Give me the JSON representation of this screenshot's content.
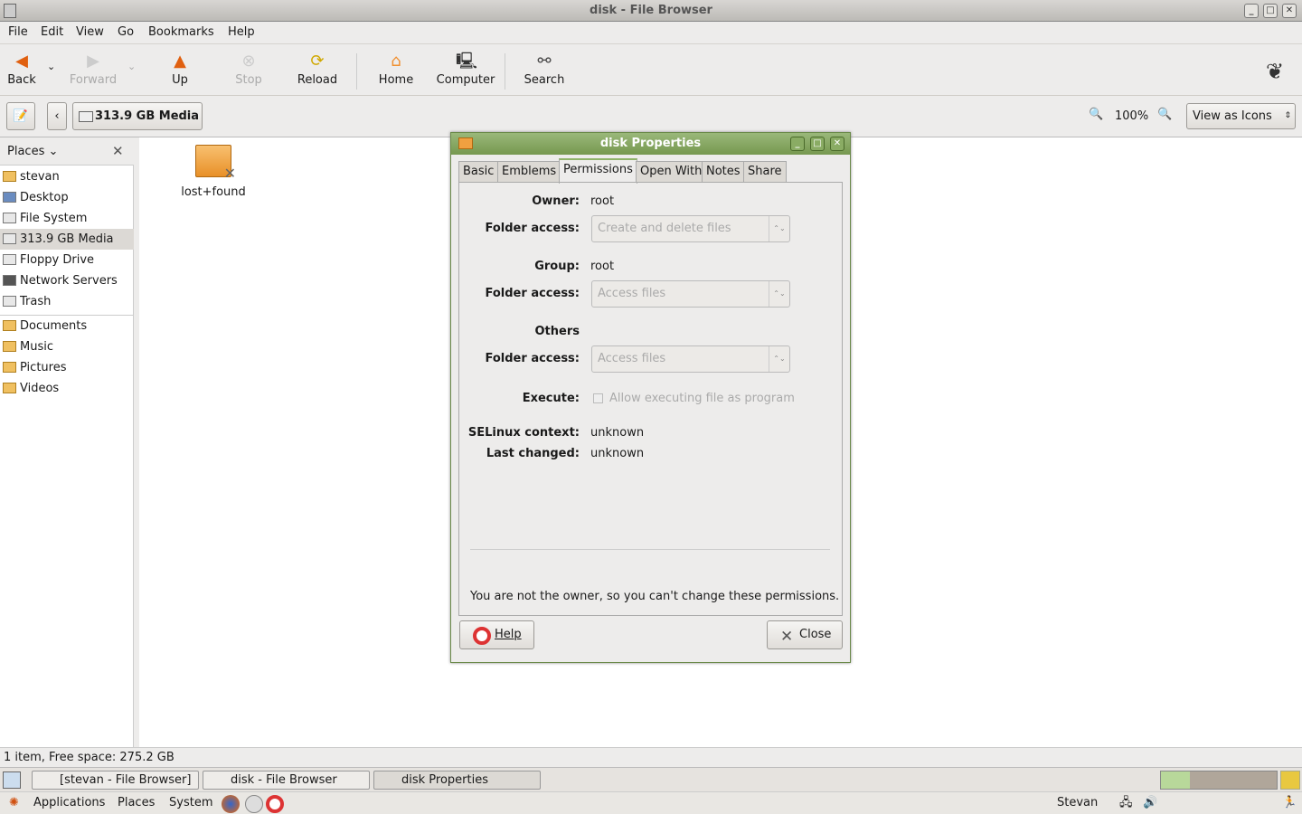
{
  "window": {
    "title": "disk - File Browser"
  },
  "menu": [
    "File",
    "Edit",
    "View",
    "Go",
    "Bookmarks",
    "Help"
  ],
  "toolbar": {
    "back": "Back",
    "forward": "Forward",
    "up": "Up",
    "stop": "Stop",
    "reload": "Reload",
    "home": "Home",
    "computer": "Computer",
    "search": "Search"
  },
  "location": {
    "path": "313.9 GB Media",
    "zoom": "100%",
    "view_mode": "View as Icons"
  },
  "sidebar": {
    "title": "Places",
    "items": [
      "stevan",
      "Desktop",
      "File System",
      "313.9 GB Media",
      "Floppy Drive",
      "Network Servers",
      "Trash"
    ],
    "bookmarks": [
      "Documents",
      "Music",
      "Pictures",
      "Videos"
    ]
  },
  "files": [
    {
      "name": "lost+found"
    }
  ],
  "status": "1 item, Free space: 275.2 GB",
  "dialog": {
    "title": "disk Properties",
    "tabs": [
      "Basic",
      "Emblems",
      "Permissions",
      "Open With",
      "Notes",
      "Share"
    ],
    "owner_label": "Owner:",
    "owner": "root",
    "folder_access_label": "Folder access:",
    "owner_access": "Create and delete files",
    "group_label": "Group:",
    "group": "root",
    "group_access": "Access files",
    "others_label": "Others",
    "others_access": "Access files",
    "execute_label": "Execute:",
    "execute_text": "Allow executing file as program",
    "selinux_label": "SELinux context:",
    "selinux": "unknown",
    "changed_label": "Last changed:",
    "changed": "unknown",
    "note": "You are not the owner, so you can't change these permissions.",
    "help": "Help",
    "close": "Close"
  },
  "taskbar": [
    "[stevan - File Browser]",
    "disk - File Browser",
    "disk Properties"
  ],
  "panel": {
    "applications": "Applications",
    "places": "Places",
    "system": "System",
    "user": "Stevan"
  }
}
